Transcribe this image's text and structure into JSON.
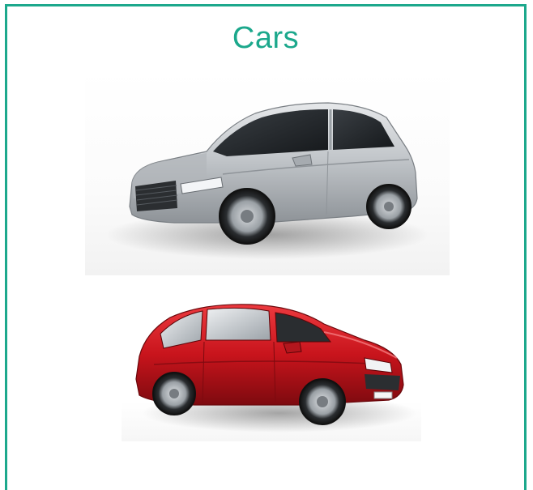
{
  "title": "Cars",
  "colors": {
    "accent": "#1ca88c",
    "silver_car": "#b8bcc0",
    "red_car": "#c8141c"
  },
  "images": [
    {
      "name": "silver-sedan-photo",
      "kind": "photo"
    },
    {
      "name": "red-hatchback-photo",
      "kind": "photo"
    }
  ]
}
